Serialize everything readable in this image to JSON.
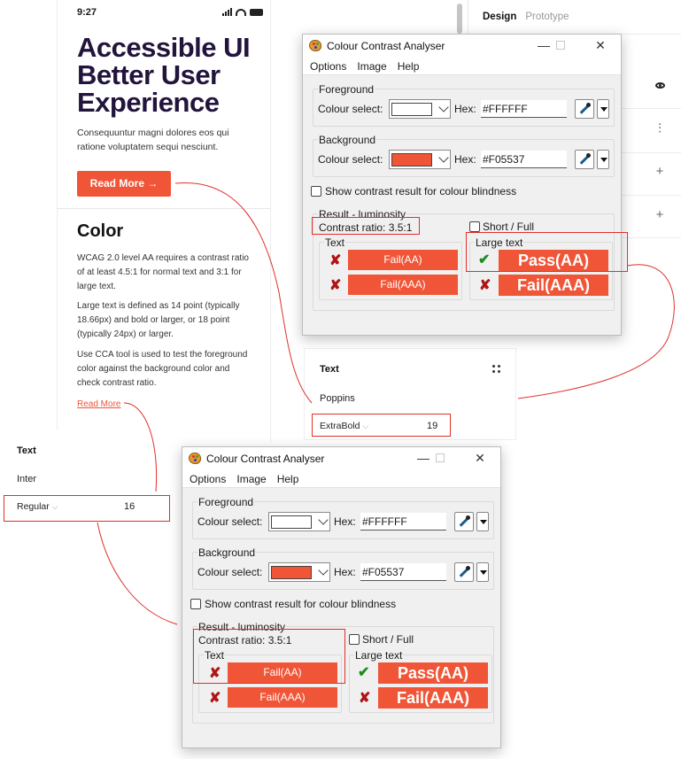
{
  "phone": {
    "time": "9:27",
    "hero_title": "Accessible UI Better User Experience",
    "hero_sub": "Consequuntur magni dolores eos qui ratione voluptatem sequi nesciunt.",
    "read_more_btn": "Read More →",
    "section_title": "Color",
    "paragraphs": [
      "WCAG 2.0 level AA requires a contrast ratio of at least 4.5:1 for normal text and 3:1 for large text.",
      "Large text is defined as 14 point (typically 18.66px) and bold or larger, or 18 point (typically 24px) or larger.",
      "Use CCA tool is used to test the foreground color against the background color and check contrast ratio."
    ],
    "read_more_link": "Read More"
  },
  "right_panel": {
    "tab_design": "Design",
    "tab_prototype": "Prototype",
    "icons": [
      "eye-icon",
      "sliders-icon",
      "plus-icon",
      "plus-icon"
    ]
  },
  "cca": {
    "title": "Colour Contrast Analyser",
    "menu": [
      "Options",
      "Image",
      "Help"
    ],
    "foreground_label": "Foreground",
    "background_label": "Background",
    "colour_select_label": "Colour select:",
    "hex_label": "Hex:",
    "foreground_hex": "#FFFFFF",
    "background_hex": "#F05537",
    "foreground_color": "#ffffff",
    "background_color": "#f05537",
    "blindness_label": "Show contrast result for colour blindness",
    "result_label": "Result - luminosity",
    "contrast_ratio": "Contrast ratio: 3.5:1",
    "short_full_label": "Short / Full",
    "text_label": "Text",
    "large_text_label": "Large text",
    "text_aa": "Fail(AA)",
    "text_aaa": "Fail(AAA)",
    "large_aa": "Pass(AA)",
    "large_aaa": "Fail(AAA)"
  },
  "inspector_top": {
    "title": "Text",
    "font": "Poppins",
    "weight": "ExtraBold",
    "size": "19"
  },
  "inspector_bottom": {
    "title": "Text",
    "font": "Inter",
    "weight": "Regular",
    "size": "16"
  },
  "colors": {
    "accent": "#f05537",
    "heading": "#22143c",
    "annotation": "#e0302a"
  }
}
